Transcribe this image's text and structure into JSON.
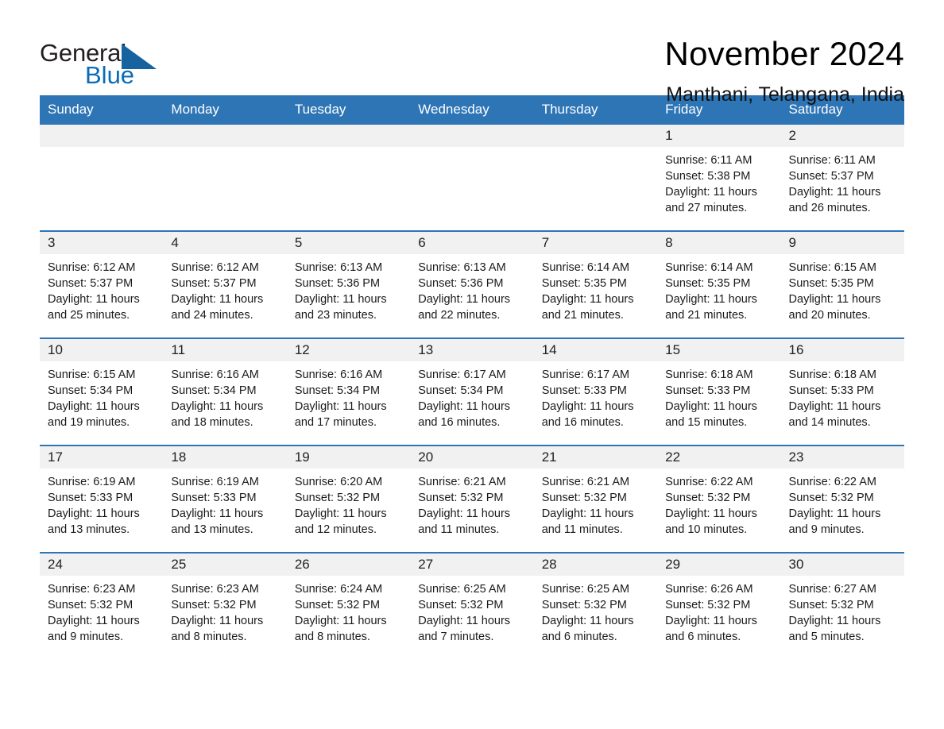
{
  "brand": {
    "name_part1": "General",
    "name_part2": "Blue",
    "logo_icon": "triangle-flag-icon",
    "colors": {
      "triangle": "#16639f",
      "blue_text": "#0a6cb8",
      "header_bar": "#2e75b6",
      "daynum_strip": "#f1f1f1"
    }
  },
  "header": {
    "title": "November 2024",
    "subtitle": "Manthani, Telangana, India"
  },
  "calendar": {
    "weekday_headers": [
      "Sunday",
      "Monday",
      "Tuesday",
      "Wednesday",
      "Thursday",
      "Friday",
      "Saturday"
    ],
    "weeks": [
      [
        {
          "empty": true
        },
        {
          "empty": true
        },
        {
          "empty": true
        },
        {
          "empty": true
        },
        {
          "empty": true
        },
        {
          "day": "1",
          "sunrise": "Sunrise: 6:11 AM",
          "sunset": "Sunset: 5:38 PM",
          "daylight": "Daylight: 11 hours and 27 minutes."
        },
        {
          "day": "2",
          "sunrise": "Sunrise: 6:11 AM",
          "sunset": "Sunset: 5:37 PM",
          "daylight": "Daylight: 11 hours and 26 minutes."
        }
      ],
      [
        {
          "day": "3",
          "sunrise": "Sunrise: 6:12 AM",
          "sunset": "Sunset: 5:37 PM",
          "daylight": "Daylight: 11 hours and 25 minutes."
        },
        {
          "day": "4",
          "sunrise": "Sunrise: 6:12 AM",
          "sunset": "Sunset: 5:37 PM",
          "daylight": "Daylight: 11 hours and 24 minutes."
        },
        {
          "day": "5",
          "sunrise": "Sunrise: 6:13 AM",
          "sunset": "Sunset: 5:36 PM",
          "daylight": "Daylight: 11 hours and 23 minutes."
        },
        {
          "day": "6",
          "sunrise": "Sunrise: 6:13 AM",
          "sunset": "Sunset: 5:36 PM",
          "daylight": "Daylight: 11 hours and 22 minutes."
        },
        {
          "day": "7",
          "sunrise": "Sunrise: 6:14 AM",
          "sunset": "Sunset: 5:35 PM",
          "daylight": "Daylight: 11 hours and 21 minutes."
        },
        {
          "day": "8",
          "sunrise": "Sunrise: 6:14 AM",
          "sunset": "Sunset: 5:35 PM",
          "daylight": "Daylight: 11 hours and 21 minutes."
        },
        {
          "day": "9",
          "sunrise": "Sunrise: 6:15 AM",
          "sunset": "Sunset: 5:35 PM",
          "daylight": "Daylight: 11 hours and 20 minutes."
        }
      ],
      [
        {
          "day": "10",
          "sunrise": "Sunrise: 6:15 AM",
          "sunset": "Sunset: 5:34 PM",
          "daylight": "Daylight: 11 hours and 19 minutes."
        },
        {
          "day": "11",
          "sunrise": "Sunrise: 6:16 AM",
          "sunset": "Sunset: 5:34 PM",
          "daylight": "Daylight: 11 hours and 18 minutes."
        },
        {
          "day": "12",
          "sunrise": "Sunrise: 6:16 AM",
          "sunset": "Sunset: 5:34 PM",
          "daylight": "Daylight: 11 hours and 17 minutes."
        },
        {
          "day": "13",
          "sunrise": "Sunrise: 6:17 AM",
          "sunset": "Sunset: 5:34 PM",
          "daylight": "Daylight: 11 hours and 16 minutes."
        },
        {
          "day": "14",
          "sunrise": "Sunrise: 6:17 AM",
          "sunset": "Sunset: 5:33 PM",
          "daylight": "Daylight: 11 hours and 16 minutes."
        },
        {
          "day": "15",
          "sunrise": "Sunrise: 6:18 AM",
          "sunset": "Sunset: 5:33 PM",
          "daylight": "Daylight: 11 hours and 15 minutes."
        },
        {
          "day": "16",
          "sunrise": "Sunrise: 6:18 AM",
          "sunset": "Sunset: 5:33 PM",
          "daylight": "Daylight: 11 hours and 14 minutes."
        }
      ],
      [
        {
          "day": "17",
          "sunrise": "Sunrise: 6:19 AM",
          "sunset": "Sunset: 5:33 PM",
          "daylight": "Daylight: 11 hours and 13 minutes."
        },
        {
          "day": "18",
          "sunrise": "Sunrise: 6:19 AM",
          "sunset": "Sunset: 5:33 PM",
          "daylight": "Daylight: 11 hours and 13 minutes."
        },
        {
          "day": "19",
          "sunrise": "Sunrise: 6:20 AM",
          "sunset": "Sunset: 5:32 PM",
          "daylight": "Daylight: 11 hours and 12 minutes."
        },
        {
          "day": "20",
          "sunrise": "Sunrise: 6:21 AM",
          "sunset": "Sunset: 5:32 PM",
          "daylight": "Daylight: 11 hours and 11 minutes."
        },
        {
          "day": "21",
          "sunrise": "Sunrise: 6:21 AM",
          "sunset": "Sunset: 5:32 PM",
          "daylight": "Daylight: 11 hours and 11 minutes."
        },
        {
          "day": "22",
          "sunrise": "Sunrise: 6:22 AM",
          "sunset": "Sunset: 5:32 PM",
          "daylight": "Daylight: 11 hours and 10 minutes."
        },
        {
          "day": "23",
          "sunrise": "Sunrise: 6:22 AM",
          "sunset": "Sunset: 5:32 PM",
          "daylight": "Daylight: 11 hours and 9 minutes."
        }
      ],
      [
        {
          "day": "24",
          "sunrise": "Sunrise: 6:23 AM",
          "sunset": "Sunset: 5:32 PM",
          "daylight": "Daylight: 11 hours and 9 minutes."
        },
        {
          "day": "25",
          "sunrise": "Sunrise: 6:23 AM",
          "sunset": "Sunset: 5:32 PM",
          "daylight": "Daylight: 11 hours and 8 minutes."
        },
        {
          "day": "26",
          "sunrise": "Sunrise: 6:24 AM",
          "sunset": "Sunset: 5:32 PM",
          "daylight": "Daylight: 11 hours and 8 minutes."
        },
        {
          "day": "27",
          "sunrise": "Sunrise: 6:25 AM",
          "sunset": "Sunset: 5:32 PM",
          "daylight": "Daylight: 11 hours and 7 minutes."
        },
        {
          "day": "28",
          "sunrise": "Sunrise: 6:25 AM",
          "sunset": "Sunset: 5:32 PM",
          "daylight": "Daylight: 11 hours and 6 minutes."
        },
        {
          "day": "29",
          "sunrise": "Sunrise: 6:26 AM",
          "sunset": "Sunset: 5:32 PM",
          "daylight": "Daylight: 11 hours and 6 minutes."
        },
        {
          "day": "30",
          "sunrise": "Sunrise: 6:27 AM",
          "sunset": "Sunset: 5:32 PM",
          "daylight": "Daylight: 11 hours and 5 minutes."
        }
      ]
    ]
  }
}
